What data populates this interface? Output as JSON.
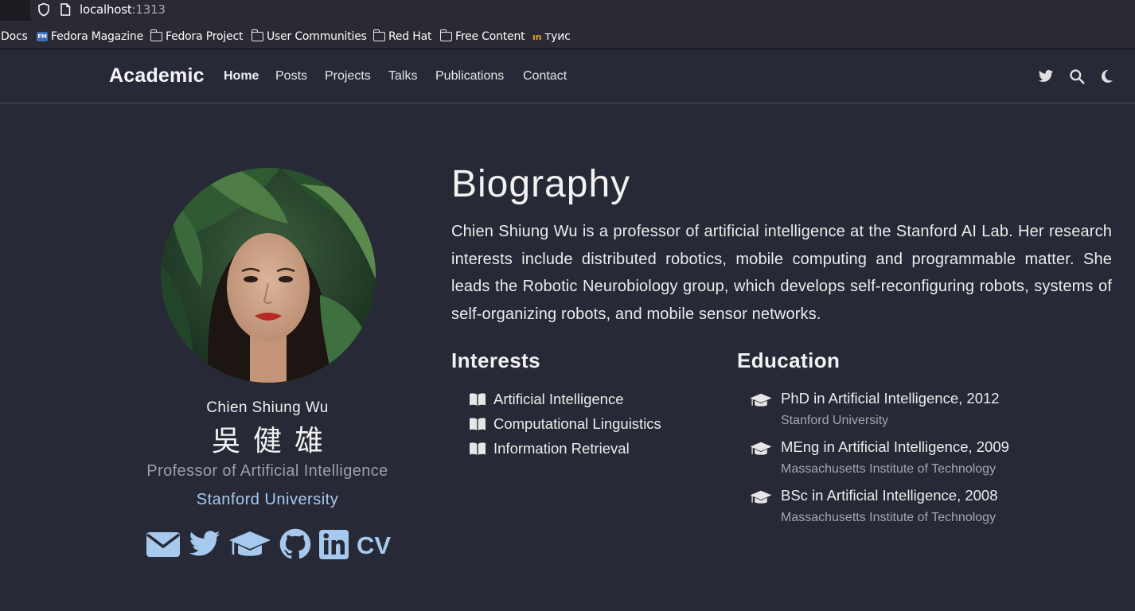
{
  "browser": {
    "url_host": "localhost",
    "url_port": ":1313",
    "bookmarks": [
      {
        "label": "Docs",
        "icon": "none"
      },
      {
        "label": "Fedora Magazine",
        "icon": "fedora-magazine-icon"
      },
      {
        "label": "Fedora Project",
        "icon": "folder-icon"
      },
      {
        "label": "User Communities",
        "icon": "folder-icon"
      },
      {
        "label": "Red Hat",
        "icon": "folder-icon"
      },
      {
        "label": "Free Content",
        "icon": "folder-icon"
      },
      {
        "label": "туис",
        "icon": "tuis-icon"
      }
    ]
  },
  "navbar": {
    "brand": "Academic",
    "links": [
      "Home",
      "Posts",
      "Projects",
      "Talks",
      "Publications",
      "Contact"
    ],
    "active": "Home",
    "icons": [
      "twitter-icon",
      "search-icon",
      "moon-icon"
    ]
  },
  "profile": {
    "name": "Chien Shiung Wu",
    "name_cn": "吳健雄",
    "role": "Professor of Artificial Intelligence",
    "organization": "Stanford University",
    "social": [
      "envelope-icon",
      "twitter-icon",
      "graduation-cap-icon",
      "github-icon",
      "linkedin-icon",
      "cv-icon"
    ],
    "cv_label": "CV"
  },
  "biography": {
    "title": "Biography",
    "text": "Chien Shiung Wu is a professor of artificial intelligence at the Stanford AI Lab. Her research interests include distributed robotics, mobile computing and programmable matter. She leads the Robotic Neurobiology group, which develops self-reconfiguring robots, systems of self-organizing robots, and mobile sensor networks."
  },
  "interests": {
    "title": "Interests",
    "items": [
      "Artificial Intelligence",
      "Computational Linguistics",
      "Information Retrieval"
    ]
  },
  "education": {
    "title": "Education",
    "items": [
      {
        "degree": "PhD in Artificial Intelligence, 2012",
        "institution": "Stanford University"
      },
      {
        "degree": "MEng in Artificial Intelligence, 2009",
        "institution": "Massachusetts Institute of Technology"
      },
      {
        "degree": "BSc in Artificial Intelligence, 2008",
        "institution": "Massachusetts Institute of Technology"
      }
    ]
  },
  "colors": {
    "background": "#272a36",
    "accent": "#a7c9ee",
    "muted": "#9c9fa8"
  }
}
